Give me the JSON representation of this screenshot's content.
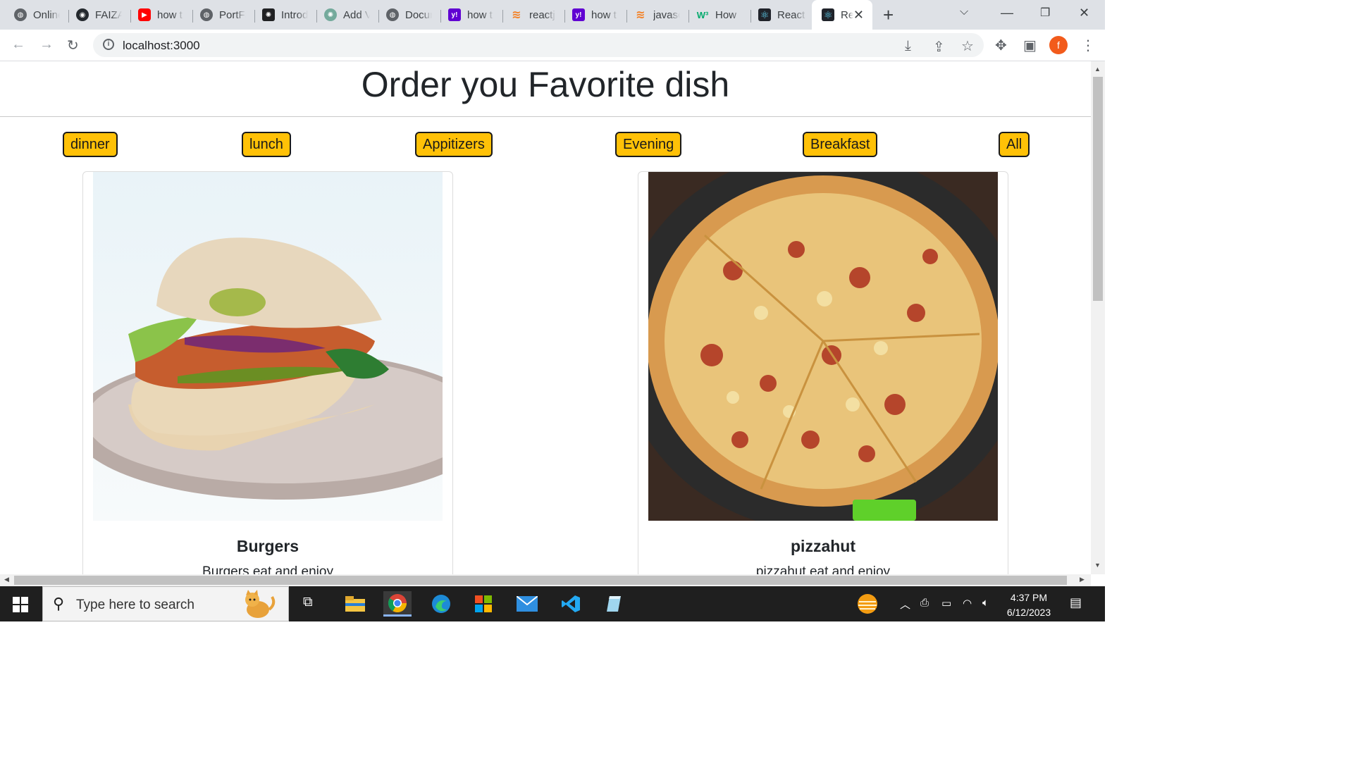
{
  "browser": {
    "tabs": [
      {
        "title": "Online",
        "icon": "globe-icon"
      },
      {
        "title": "FAIZA",
        "icon": "github-icon"
      },
      {
        "title": "how t",
        "icon": "youtube-icon"
      },
      {
        "title": "PortFl",
        "icon": "globe-icon"
      },
      {
        "title": "Introd",
        "icon": "chatgpt-icon"
      },
      {
        "title": "Add V",
        "icon": "chatgpt-icon"
      },
      {
        "title": "Docur",
        "icon": "globe-icon"
      },
      {
        "title": "how t",
        "icon": "yahoo-icon"
      },
      {
        "title": "reactj",
        "icon": "stackoverflow-icon"
      },
      {
        "title": "how t",
        "icon": "yahoo-icon"
      },
      {
        "title": "javasc",
        "icon": "stackoverflow-icon"
      },
      {
        "title": "How",
        "icon": "w3schools-icon"
      },
      {
        "title": "React",
        "icon": "react-icon"
      },
      {
        "title": "Re",
        "icon": "react-icon"
      }
    ],
    "url": "localhost:3000",
    "profile_initial": "f"
  },
  "page": {
    "heading": "Order you Favorite dish",
    "categories": [
      "dinner",
      "lunch",
      "Appitizers",
      "Evening",
      "Breakfast",
      "All"
    ],
    "cards": [
      {
        "title": "Burgers",
        "description": "Burgers eat and enjoy"
      },
      {
        "title": "pizzahut",
        "description": "pizzahut eat and enjoy"
      }
    ]
  },
  "taskbar": {
    "search_placeholder": "Type here to search",
    "time": "4:37 PM",
    "date": "6/12/2023"
  },
  "colors": {
    "button_bg": "#ffc107",
    "tab_strip": "#dee1e6",
    "taskbar": "#1f1f1f"
  }
}
